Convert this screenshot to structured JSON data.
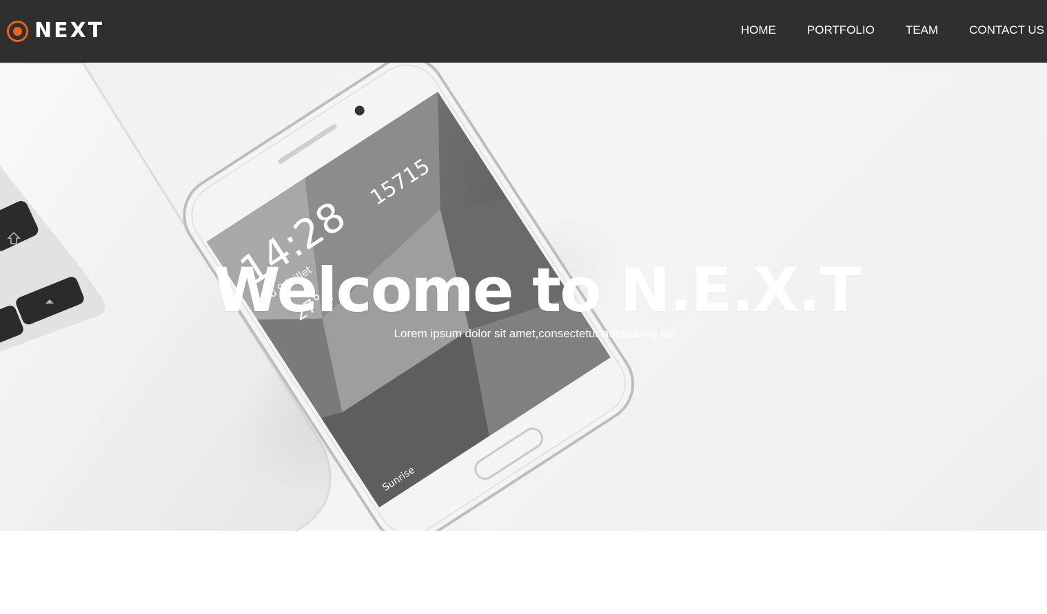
{
  "brand": {
    "name": "NEXT",
    "icon": "target-circle-icon",
    "accent_color": "#e8641b"
  },
  "nav": {
    "items": [
      {
        "label": "HOME"
      },
      {
        "label": "PORTFOLIO"
      },
      {
        "label": "TEAM"
      },
      {
        "label": "CONTACT US"
      }
    ]
  },
  "hero": {
    "title": "Welcome to N.E.X.T",
    "subtitle": "Lorem ipsum dolor sit amet,consectetur adipisicing elit.",
    "phone": {
      "time": "14:28",
      "date": "jeu 9 juillet",
      "temperature": "27°c",
      "steps": "15715",
      "status_time": "14:28",
      "caption": "Sunrise"
    }
  },
  "colors": {
    "navbar_bg": "#2f2f2f",
    "hero_bg": "#f2f2f2",
    "text_light": "#ffffff"
  }
}
